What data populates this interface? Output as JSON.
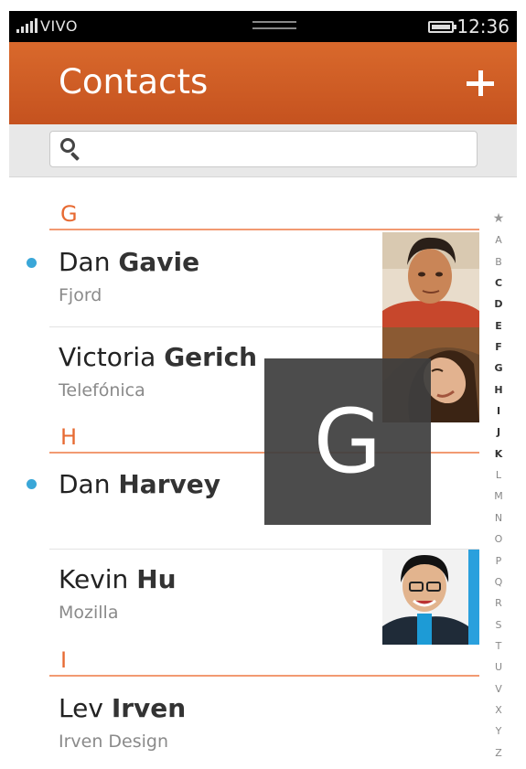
{
  "status_bar": {
    "carrier": "VIVO",
    "time": "12:36"
  },
  "header": {
    "title": "Contacts"
  },
  "search": {
    "placeholder": ""
  },
  "sections": [
    {
      "letter": "G"
    },
    {
      "letter": "H"
    },
    {
      "letter": "I"
    }
  ],
  "contacts": [
    {
      "first": "Dan",
      "last": "Gavie",
      "org": "Fjord",
      "unread": true
    },
    {
      "first": "Victoria",
      "last": "Gerich",
      "org": "Telefónica",
      "unread": false
    },
    {
      "first": "Dan",
      "last": "Harvey",
      "org": "",
      "unread": true
    },
    {
      "first": "Kevin",
      "last": "Hu",
      "org": "Mozilla",
      "unread": false
    },
    {
      "first": "Lev",
      "last": "Irven",
      "org": "Irven Design",
      "unread": false
    }
  ],
  "index": {
    "star": "★",
    "letters": [
      "A",
      "B",
      "C",
      "D",
      "E",
      "F",
      "G",
      "H",
      "I",
      "J",
      "K",
      "L",
      "M",
      "N",
      "O",
      "P",
      "Q",
      "R",
      "S",
      "T",
      "U",
      "V",
      "X",
      "Y",
      "Z"
    ],
    "bold_letters": [
      "C",
      "D",
      "E",
      "F",
      "G",
      "H",
      "I",
      "J",
      "K"
    ]
  },
  "overlay": {
    "letter": "G"
  },
  "colors": {
    "header": "#c9561f",
    "accent": "#e76a32",
    "unread_dot": "#3aa7d8"
  }
}
